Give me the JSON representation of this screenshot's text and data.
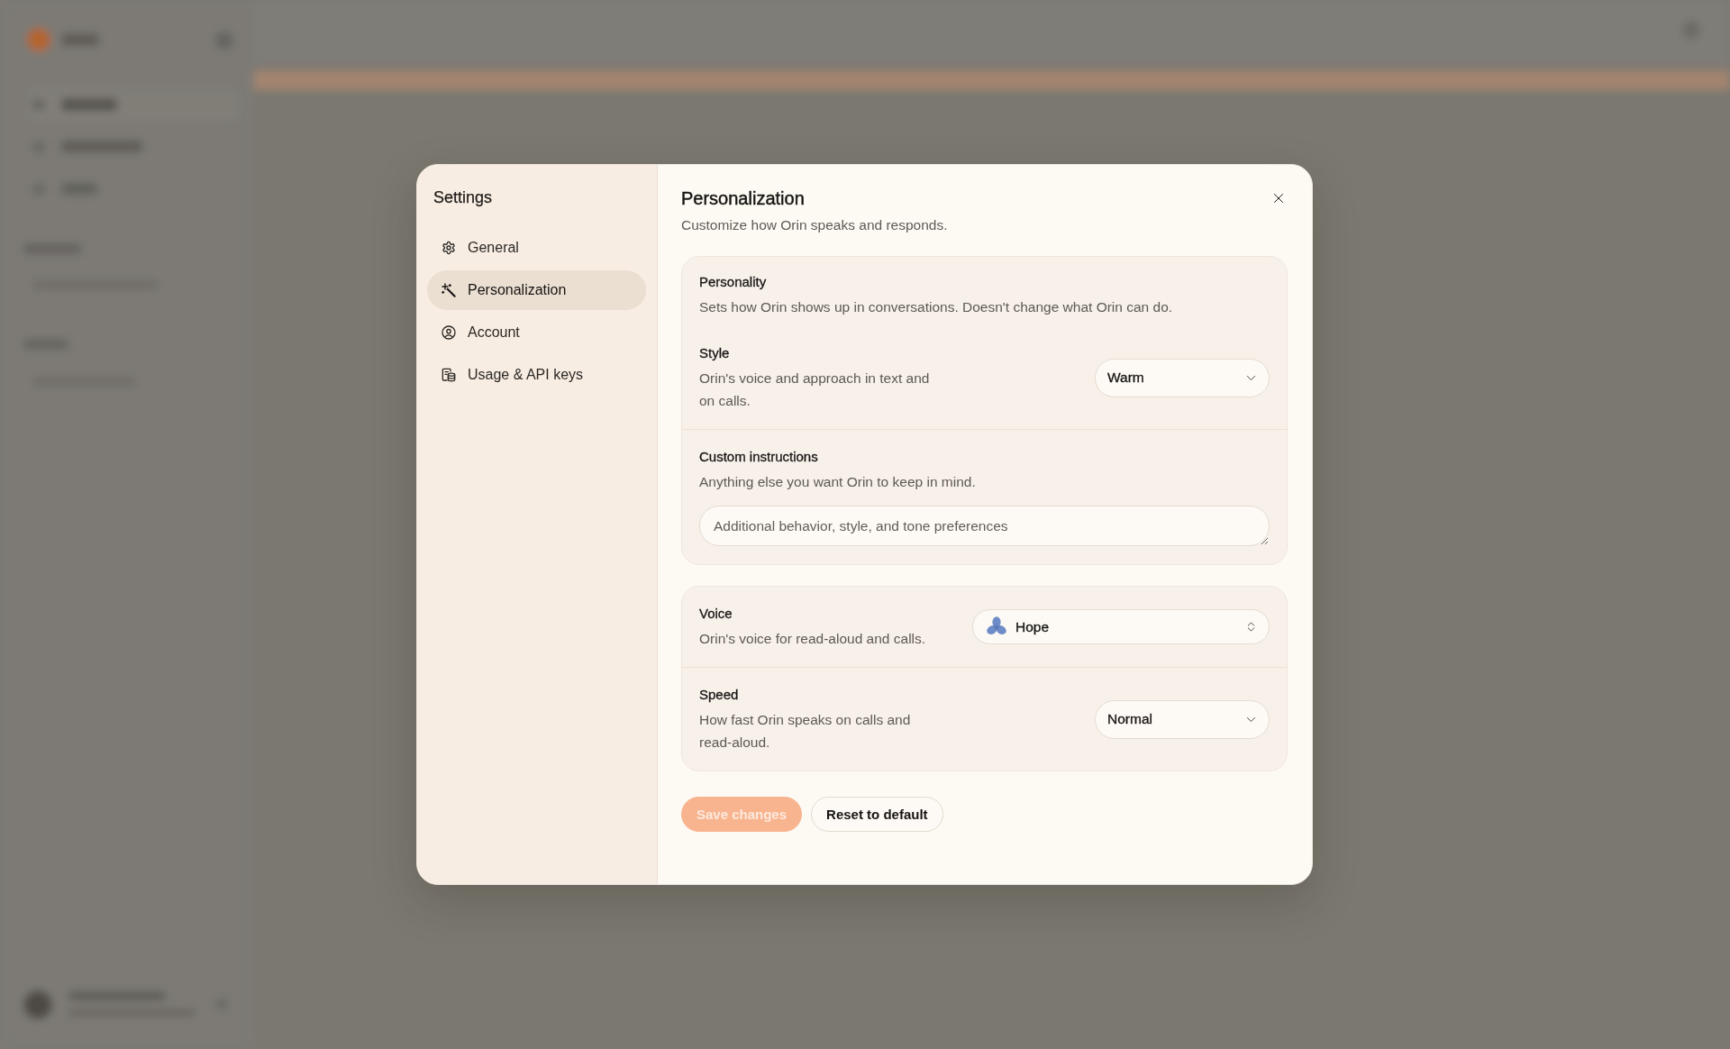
{
  "sidebar": {
    "title": "Settings",
    "items": [
      {
        "label": "General",
        "selected": false
      },
      {
        "label": "Personalization",
        "selected": true
      },
      {
        "label": "Account",
        "selected": false
      },
      {
        "label": "Usage & API keys",
        "selected": false
      }
    ]
  },
  "panel": {
    "title": "Personalization",
    "subtitle": "Customize how Orin speaks and responds.",
    "cards": [
      {
        "title": "Personality",
        "description": "Sets how Orin shows up in conversations. Doesn't change what Orin can do.",
        "rows": [
          {
            "kind": "select",
            "label": "Style",
            "description": "Orin's voice and approach in text and on calls.",
            "value": "Warm"
          },
          {
            "kind": "textarea",
            "label": "Custom instructions",
            "description": "Anything else you want Orin to keep in mind.",
            "placeholder": "Additional behavior, style, and tone preferences"
          }
        ]
      },
      {
        "rows": [
          {
            "kind": "voice",
            "label": "Voice",
            "description": "Orin's voice for read-aloud and calls.",
            "value": "Hope"
          },
          {
            "kind": "select",
            "label": "Speed",
            "description": "How fast Orin speaks on calls and read-aloud.",
            "value": "Normal"
          }
        ]
      }
    ],
    "buttons": [
      {
        "kind": "primary",
        "label": "Save changes",
        "disabled": true
      },
      {
        "kind": "secondary",
        "label": "Reset to default",
        "disabled": false
      }
    ]
  }
}
